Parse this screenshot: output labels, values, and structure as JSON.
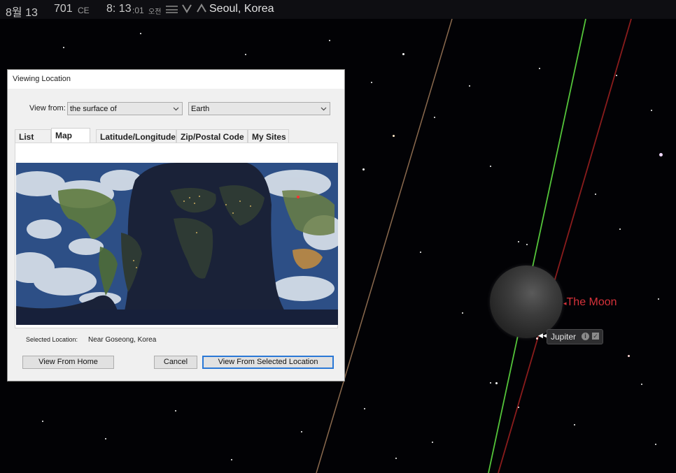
{
  "topbar": {
    "date": "8월 13",
    "year": "701",
    "era": "CE",
    "time": "8: 13",
    "seconds": ":01",
    "ampm": "오전",
    "location": "Seoul, Korea",
    "menu_icon": "hamburger-menu-icon",
    "down_icon": "chevron-down-icon",
    "up_icon": "chevron-up-icon"
  },
  "sky": {
    "moon_label": "The Moon",
    "jupiter_label": "Jupiter",
    "info_glyph": "i",
    "check_glyph": "✓",
    "pointer_glyph": "◀◀",
    "colors": {
      "moon_label": "#d6323a",
      "ecliptic_line": "#8a6a4e",
      "green_line": "#54c43a",
      "red_line": "#8a1c1c",
      "background": "#020205"
    }
  },
  "dialog": {
    "title": "Viewing Location",
    "view_from_label": "View from:",
    "view_from_value": "the surface of",
    "body_value": "Earth",
    "tabs": [
      {
        "label": "List",
        "active": false
      },
      {
        "label": "Map",
        "active": true
      },
      {
        "label": "Latitude/Longitude",
        "active": false
      },
      {
        "label": "Zip/Postal Code",
        "active": false
      },
      {
        "label": "My Sites",
        "active": false
      }
    ],
    "selected_location_label": "Selected Location:",
    "selected_location_value": "Near Goseong, Korea",
    "buttons": {
      "view_from_home": "View From Home",
      "cancel": "Cancel",
      "view_from_selected": "View From Selected Location"
    },
    "accent_color": "#2a78d6"
  }
}
